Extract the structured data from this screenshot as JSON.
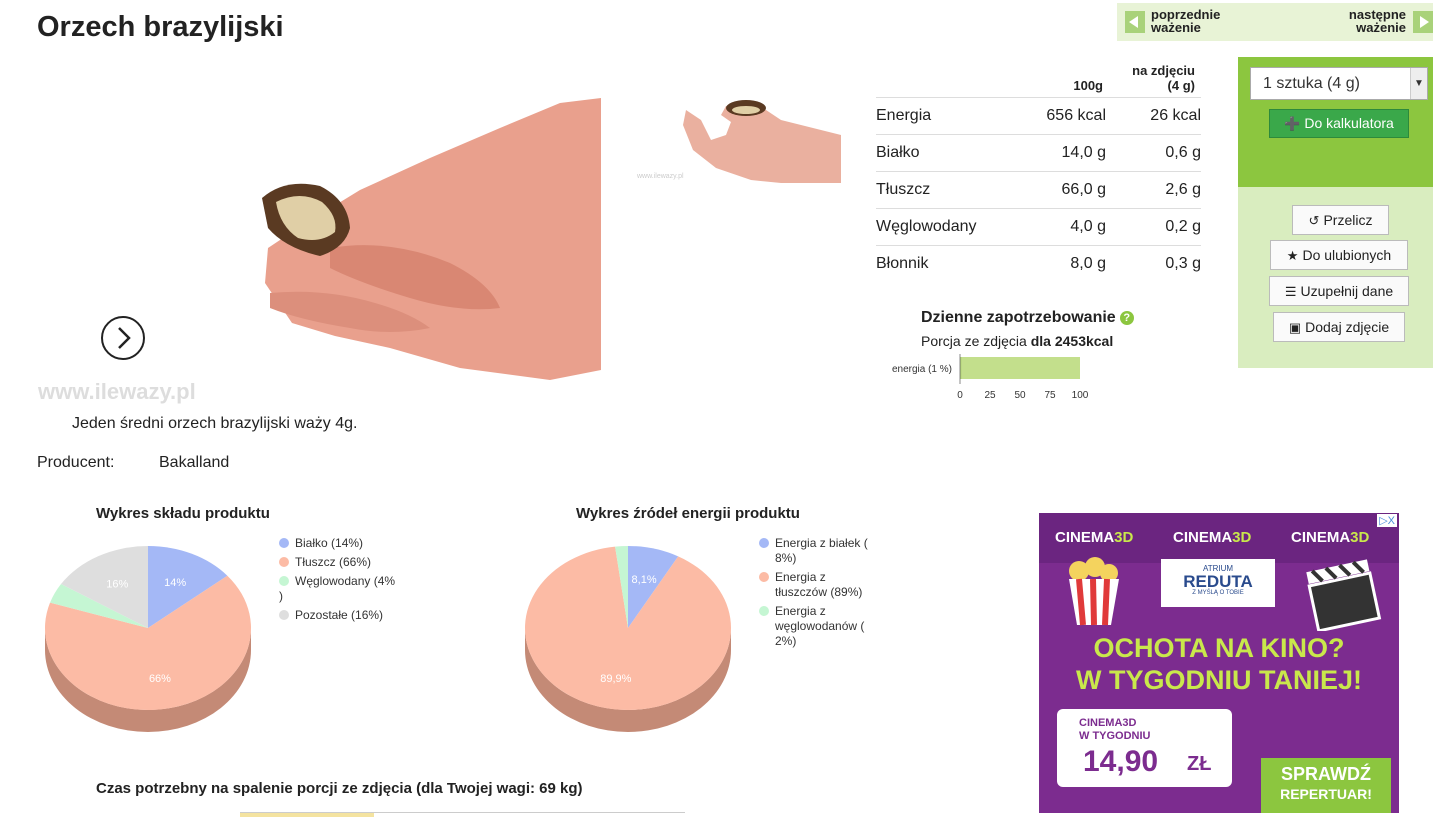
{
  "page": {
    "title": "Orzech brazylijski"
  },
  "nav": {
    "prev_label": "poprzednie ważenie",
    "prev_l1": "poprzednie",
    "prev_l2": "ważenie",
    "next_l1": "następne",
    "next_l2": "ważenie"
  },
  "photo": {
    "watermark": "www.ilewazy.pl",
    "small_watermark": "www.ilewazy.pl"
  },
  "description": "Jeden średni orzech brazylijski waży 4g.",
  "producer": {
    "label": "Producent:",
    "value": "Bakalland"
  },
  "nutrition": {
    "col_100g": "100g",
    "col_photo_l1": "na zdjęciu",
    "col_photo_l2": "(4 g)",
    "rows": [
      {
        "name": "Energia",
        "per100": "656 kcal",
        "photo": "26 kcal"
      },
      {
        "name": "Białko",
        "per100": "14,0 g",
        "photo": "0,6 g"
      },
      {
        "name": "Tłuszcz",
        "per100": "66,0 g",
        "photo": "2,6 g"
      },
      {
        "name": "Węglowodany",
        "per100": "4,0 g",
        "photo": "0,2 g"
      },
      {
        "name": "Błonnik",
        "per100": "8,0 g",
        "photo": "0,3 g"
      }
    ]
  },
  "calc": {
    "portion_selected": "1 sztuka (4 g)",
    "add_button": "Do kalkulatora",
    "recalc_button": "Przelicz",
    "favorite_button": "Do ulubionych",
    "complete_button": "Uzupełnij dane",
    "photo_button": "Dodaj zdjęcie"
  },
  "daily": {
    "title": "Dzienne zapotrzebowanie",
    "help": "?",
    "subtitle_prefix": "Porcja ze zdjęcia ",
    "subtitle_bold": "dla 2453kcal"
  },
  "chart_data": [
    {
      "type": "bar",
      "orientation": "horizontal",
      "categories": [
        "energia (1 %)"
      ],
      "values": [
        1
      ],
      "xlim": [
        0,
        100
      ],
      "xticks": [
        "0",
        "25",
        "50",
        "75",
        "100"
      ],
      "color": "#c3df8c"
    },
    {
      "type": "pie",
      "title": "Wykres składu produktu",
      "labels": [
        "Białko (14%)",
        "Tłuszcz (66%)",
        "Węglowodany (4%)",
        "Pozostałe (16%)"
      ],
      "values": [
        14,
        66,
        4,
        16
      ],
      "slice_labels": [
        "14%",
        "66%",
        "",
        "16%"
      ],
      "colors": [
        "#a4b8f6",
        "#fcbba5",
        "#c5f6d3",
        "#dedede"
      ]
    },
    {
      "type": "pie",
      "title": "Wykres źródeł energii produktu",
      "labels": [
        "Energia z białek (8%)",
        "Energia z tłuszczów (89%)",
        "Energia z węglowodanów (2%)"
      ],
      "values": [
        8.1,
        89.9,
        2
      ],
      "slice_labels": [
        "8,1%",
        "89,9%",
        ""
      ],
      "colors": [
        "#a4b8f6",
        "#fcbba5",
        "#c5f6d3"
      ]
    }
  ],
  "legend1": {
    "items": [
      "Białko (14%)",
      "Tłuszcz (66%)",
      "Węglowodany (4%",
      ")",
      "Pozostałe (16%)"
    ]
  },
  "legend2": {
    "items": [
      "Energia z białek (",
      "8%)",
      "Energia z",
      "tłuszczów (89%)",
      "Energia z",
      "węglowodanów (",
      "2%)"
    ]
  },
  "burn": {
    "title": "Czas potrzebny na spalenie porcji ze zdjęcia (dla Twojej wagi: 69 kg)"
  },
  "ad": {
    "brand_a": "CINEMA",
    "brand_b": "3D",
    "partner_l1": "ATRIUM",
    "partner_l2": "REDUTA",
    "partner_l3": "Z MYŚLĄ O TOBIE",
    "headline_l1": "OCHOTA NA KINO?",
    "headline_l2": "W TYGODNIU TANIEJ!",
    "ticket_brand": "CINEMA3D",
    "ticket_sub": "W TYGODNIU",
    "ticket_price": "14,90",
    "ticket_currency": "ZŁ",
    "cta_l1": "SPRAWDŹ",
    "cta_l2": "REPERTUAR!",
    "adchoices": "▷X"
  }
}
